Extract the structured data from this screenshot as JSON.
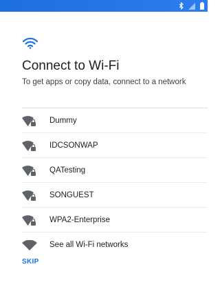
{
  "status_bar": {
    "icons": [
      "bluetooth-icon",
      "signal-icon",
      "battery-icon"
    ],
    "color": "#1e6fe0"
  },
  "header": {
    "icon": "wifi-icon",
    "title": "Connect to Wi-Fi",
    "subtitle": "To get apps or copy data, connect to a network"
  },
  "networks": [
    {
      "name": "Dummy",
      "icon": "wifi-lock-icon"
    },
    {
      "name": "IDCSONWAP",
      "icon": "wifi-lock-icon"
    },
    {
      "name": "QATesting",
      "icon": "wifi-lock-icon"
    },
    {
      "name": "SONGUEST",
      "icon": "wifi-lock-icon"
    },
    {
      "name": "WPA2-Enterprise",
      "icon": "wifi-lock-icon"
    }
  ],
  "see_all": {
    "label": "See all Wi-Fi networks",
    "icon": "wifi-icon"
  },
  "footer": {
    "skip_label": "SKIP"
  },
  "colors": {
    "accent": "#1a73e8",
    "icon_gray": "#5f6368"
  }
}
